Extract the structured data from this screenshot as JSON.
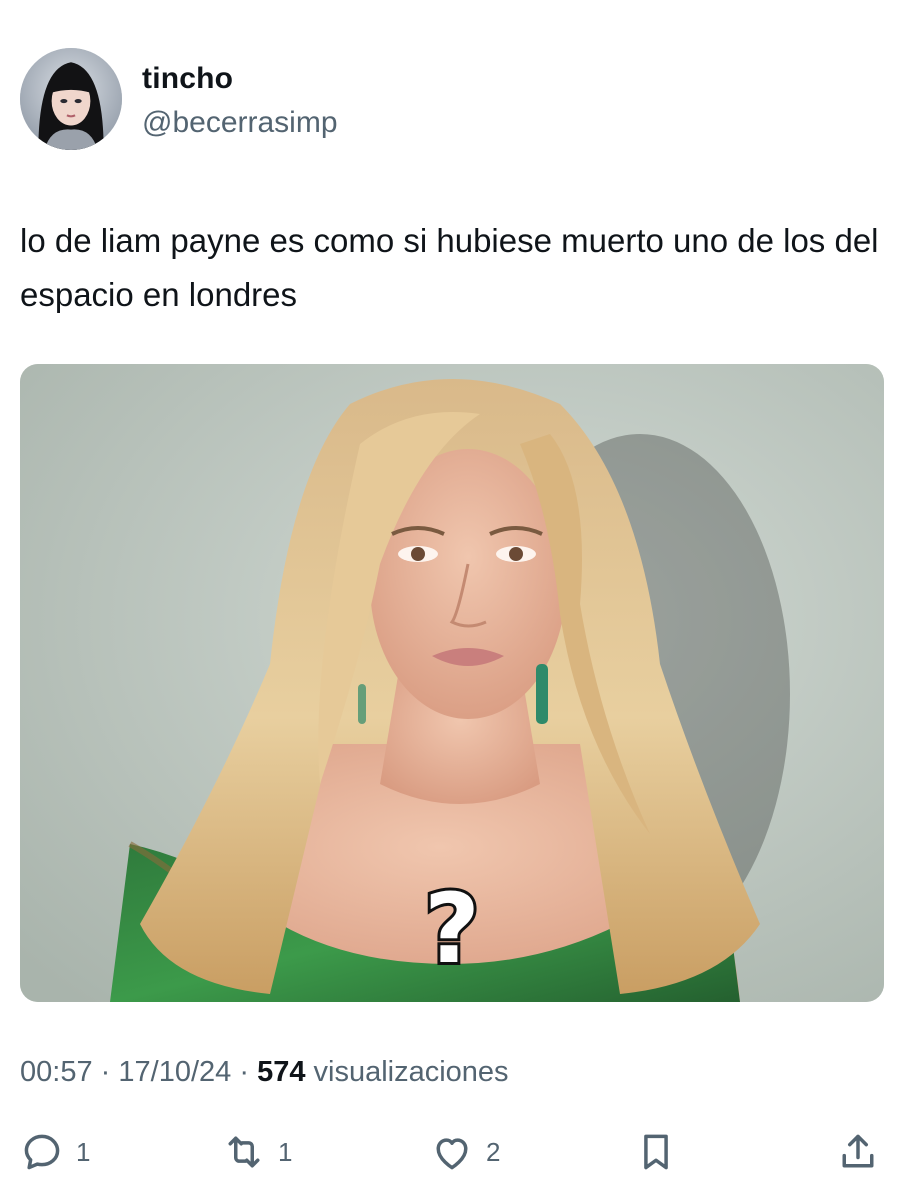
{
  "user": {
    "display_name": "tincho",
    "handle": "@becerrasimp",
    "avatar_icon": "profile-photo"
  },
  "tweet": {
    "text": "lo de liam payne es como si hubiese muerto uno de los del espacio en londres",
    "media": {
      "overlay_text": "?",
      "alt": "photo"
    }
  },
  "meta": {
    "time": "00:57",
    "separator": "·",
    "date": "17/10/24",
    "views_count": "574",
    "views_label": "visualizaciones"
  },
  "actions": {
    "reply_icon": "reply-icon",
    "reply_count": "1",
    "retweet_icon": "retweet-icon",
    "retweet_count": "1",
    "like_icon": "heart-icon",
    "like_count": "2",
    "bookmark_icon": "bookmark-icon",
    "share_icon": "share-icon"
  },
  "colors": {
    "text_primary": "#0f1419",
    "text_secondary": "#536471",
    "background": "#ffffff"
  }
}
